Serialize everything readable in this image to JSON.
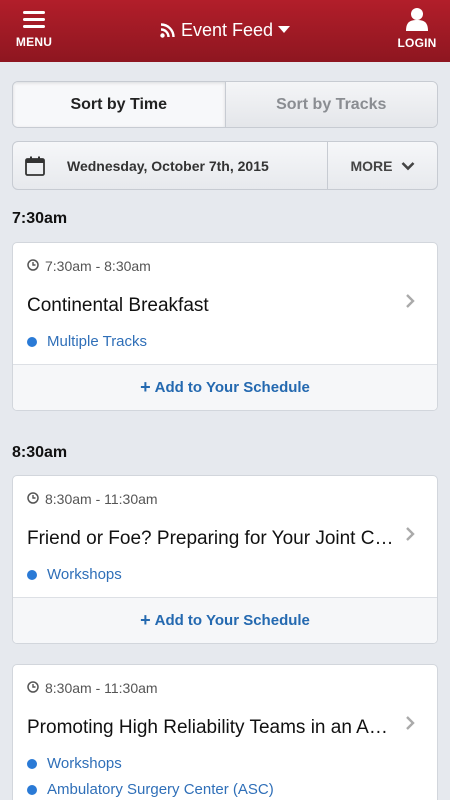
{
  "header": {
    "menu_label": "MENU",
    "title": "Event Feed",
    "login_label": "LOGIN"
  },
  "sort": {
    "time_label": "Sort by Time",
    "tracks_label": "Sort by Tracks"
  },
  "datebar": {
    "date": "Wednesday, October 7th, 2015",
    "more_label": "MORE"
  },
  "groups": [
    {
      "time": "7:30am"
    },
    {
      "time": "8:30am"
    }
  ],
  "sessions": [
    {
      "time": "7:30am - 8:30am",
      "title": "Continental Breakfast",
      "tracks": [
        "Multiple Tracks"
      ],
      "add_label": "Add to Your Schedule"
    },
    {
      "time": "8:30am - 11:30am",
      "title": "Friend or Foe? Preparing for Your Joint Commission Survey",
      "tracks": [
        "Workshops"
      ],
      "add_label": "Add to Your Schedule"
    },
    {
      "time": "8:30am - 11:30am",
      "title": "Promoting High Reliability Teams in an Ambulatory Setting",
      "tracks": [
        "Workshops",
        "Ambulatory Surgery Center (ASC)"
      ]
    }
  ],
  "colors": {
    "header_red": "#a51c27",
    "link_blue": "#2469b0",
    "track_dot": "#2a7ad6"
  },
  "icons": {
    "menu": "hamburger-icon",
    "feed": "rss-icon",
    "dropdown": "caret-down-icon",
    "login": "user-icon",
    "calendar": "calendar-icon",
    "more": "chevron-down-icon",
    "time": "clock-icon",
    "open": "chevron-right-icon",
    "add": "plus-icon"
  }
}
